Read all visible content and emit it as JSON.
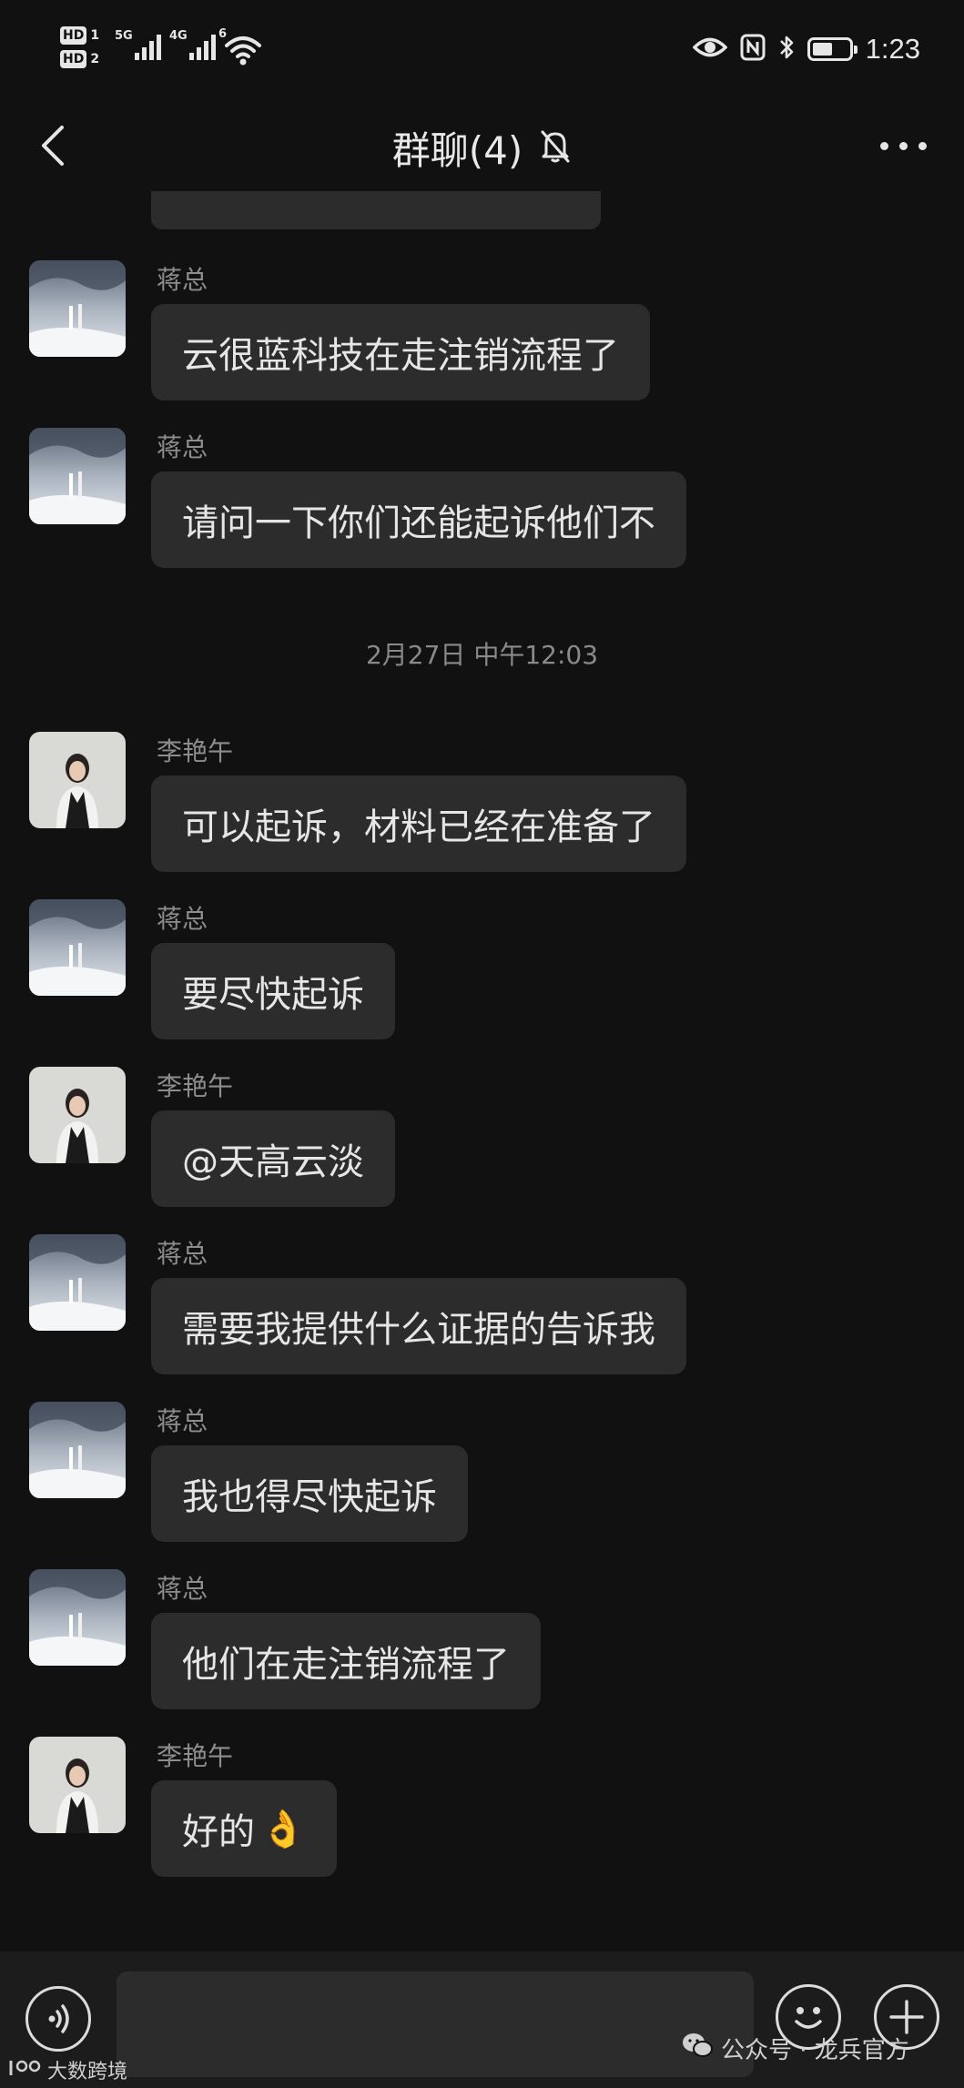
{
  "status_bar": {
    "sim1_tag": "HD",
    "sim1_num": "1",
    "sim2_tag": "HD",
    "sim2_num": "2",
    "net1": "5G",
    "net2": "4G",
    "wifi_label": "6",
    "time": "1:23",
    "battery_level": 0.55
  },
  "header": {
    "title": "群聊(4)"
  },
  "chat": {
    "timestamp": "2月27日 中午12:03",
    "messages": [
      {
        "sender": "蒋总",
        "text": "云很蓝科技在走注销流程了"
      },
      {
        "sender": "蒋总",
        "text": "请问一下你们还能起诉他们不"
      },
      {
        "sender": "李艳午",
        "text": "可以起诉，材料已经在准备了"
      },
      {
        "sender": "蒋总",
        "text": "要尽快起诉"
      },
      {
        "sender": "李艳午",
        "text": "@天高云淡"
      },
      {
        "sender": "蒋总",
        "text": "需要我提供什么证据的告诉我"
      },
      {
        "sender": "蒋总",
        "text": "我也得尽快起诉"
      },
      {
        "sender": "蒋总",
        "text": "他们在走注销流程了"
      },
      {
        "sender": "李艳午",
        "text": "好的",
        "emoji": "👌"
      }
    ]
  },
  "watermarks": {
    "left": "大数跨境",
    "right": "公众号 · 龙兵官方"
  },
  "icons": {
    "back": "chevron-left-icon",
    "mute": "bell-off-icon",
    "more": "more-dots-icon",
    "voice": "voice-icon",
    "emoji": "emoji-icon",
    "plus": "plus-icon",
    "wechat": "wechat-icon"
  }
}
